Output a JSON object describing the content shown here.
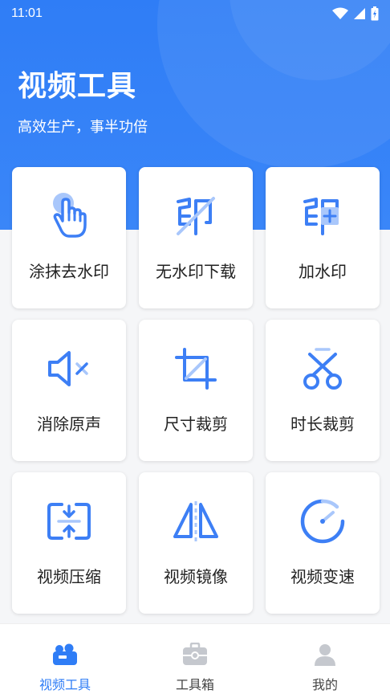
{
  "status_bar": {
    "time": "11:01"
  },
  "header": {
    "title": "视频工具",
    "subtitle": "高效生产，事半功倍"
  },
  "tools": [
    {
      "label": "涂抹去水印",
      "icon": "hand-pointer-icon"
    },
    {
      "label": "无水印下载",
      "icon": "no-watermark-icon"
    },
    {
      "label": "加水印",
      "icon": "add-watermark-icon"
    },
    {
      "label": "消除原声",
      "icon": "mute-icon"
    },
    {
      "label": "尺寸裁剪",
      "icon": "crop-icon"
    },
    {
      "label": "时长裁剪",
      "icon": "scissors-icon"
    },
    {
      "label": "视频压缩",
      "icon": "compress-icon"
    },
    {
      "label": "视频镜像",
      "icon": "mirror-icon"
    },
    {
      "label": "视频变速",
      "icon": "speed-icon"
    }
  ],
  "tab_bar": [
    {
      "label": "视频工具",
      "icon": "camera-icon",
      "active": true
    },
    {
      "label": "工具箱",
      "icon": "toolbox-icon",
      "active": false
    },
    {
      "label": "我的",
      "icon": "user-icon",
      "active": false
    }
  ],
  "colors": {
    "accent": "#2f7df6",
    "icon_blue": "#3d7ff5",
    "icon_light": "#a9c7fb"
  }
}
